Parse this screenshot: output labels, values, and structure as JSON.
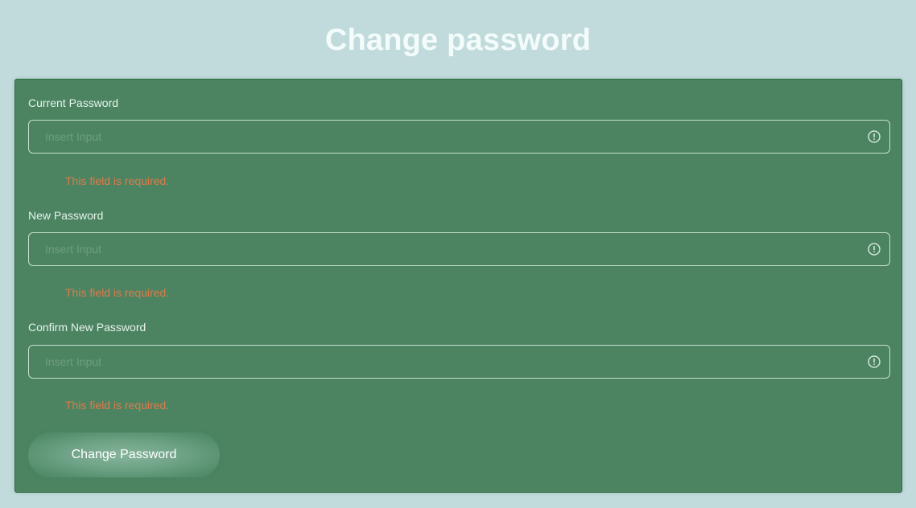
{
  "page": {
    "title": "Change password"
  },
  "form": {
    "fields": [
      {
        "label": "Current Password",
        "placeholder": "Insert Input",
        "value": "",
        "error": "This field is required.",
        "icon": "alert-circle-icon"
      },
      {
        "label": "New Password",
        "placeholder": "Insert Input",
        "value": "",
        "error": "This field is required.",
        "icon": "alert-circle-icon"
      },
      {
        "label": "Confirm New Password",
        "placeholder": "Insert Input",
        "value": "",
        "error": "This field is required.",
        "icon": "alert-circle-icon"
      }
    ],
    "submit_label": "Change Password"
  },
  "colors": {
    "background": "#c1dbdc",
    "card": "#4c8462",
    "error": "#e07a4a",
    "title": "#f3fbfb"
  }
}
